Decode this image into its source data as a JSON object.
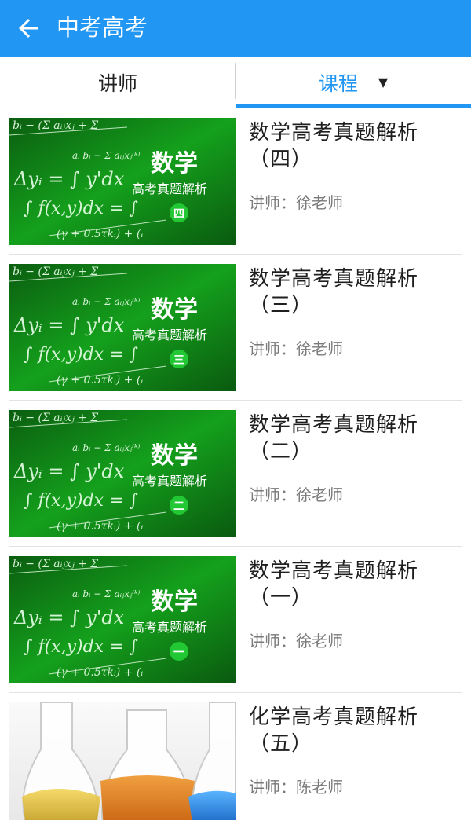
{
  "appbar": {
    "title": "中考高考"
  },
  "tabs": {
    "teacher": "讲师",
    "course": "课程"
  },
  "courses": [
    {
      "title_line1": "数学高考真题解析",
      "title_line2": "（四）",
      "teacher": "讲师：徐老师",
      "thumb": {
        "subject": "数学",
        "caption": "高考真题解析",
        "badge": "四"
      }
    },
    {
      "title_line1": "数学高考真题解析",
      "title_line2": "（三）",
      "teacher": "讲师：徐老师",
      "thumb": {
        "subject": "数学",
        "caption": "高考真题解析",
        "badge": "三"
      }
    },
    {
      "title_line1": "数学高考真题解析",
      "title_line2": "（二）",
      "teacher": "讲师：徐老师",
      "thumb": {
        "subject": "数学",
        "caption": "高考真题解析",
        "badge": "二"
      }
    },
    {
      "title_line1": "数学高考真题解析",
      "title_line2": "（一）",
      "teacher": "讲师：徐老师",
      "thumb": {
        "subject": "数学",
        "caption": "高考真题解析",
        "badge": "一"
      }
    },
    {
      "title_line1": "化学高考真题解析",
      "title_line2": "（五）",
      "teacher": "讲师：陈老师"
    }
  ],
  "colors": {
    "primary": "#2196F3",
    "thumb_green": "#0f8a16",
    "badge_green": "#19c02a"
  },
  "icons": {
    "back": "arrow-left-icon",
    "dropdown": "caret-down-icon"
  }
}
